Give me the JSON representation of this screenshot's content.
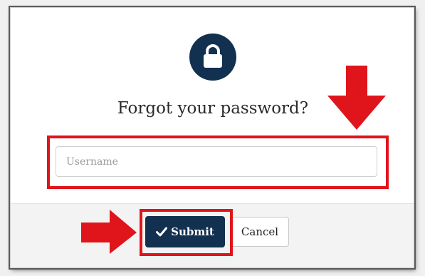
{
  "dialog": {
    "title": "Forgot your password?",
    "lock_icon": "lock-icon"
  },
  "form": {
    "username_placeholder": "Username",
    "username_value": ""
  },
  "actions": {
    "submit_label": "Submit",
    "submit_icon": "checkmark-icon",
    "cancel_label": "Cancel"
  },
  "colors": {
    "primary": "#12304f",
    "annotation": "#e0141b"
  }
}
